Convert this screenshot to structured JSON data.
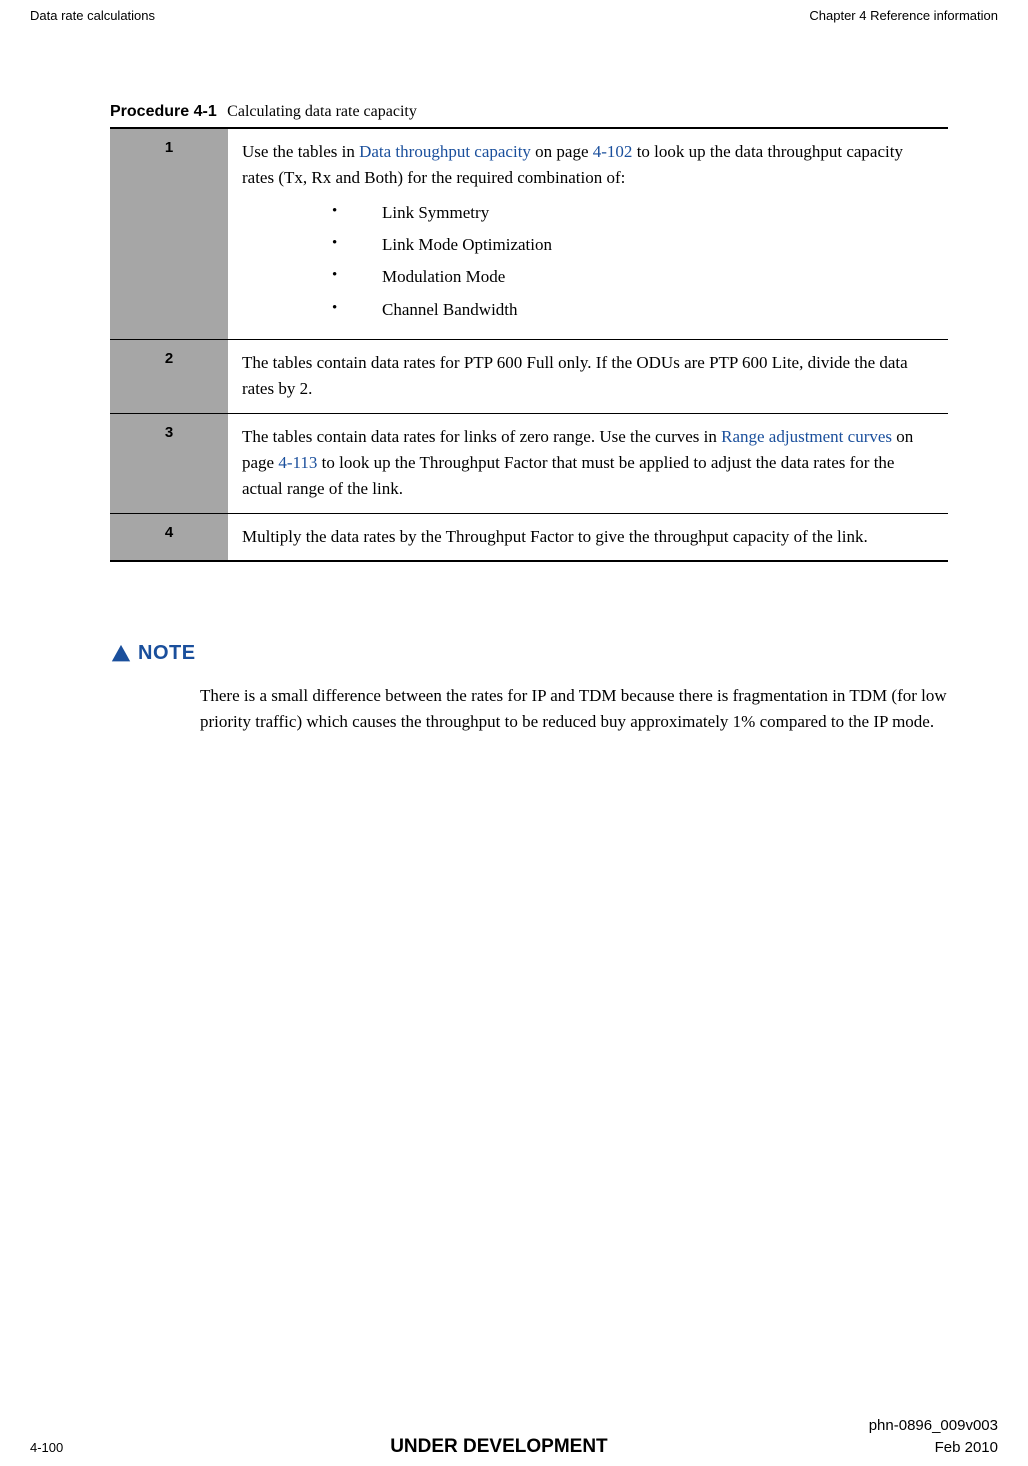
{
  "header": {
    "left": "Data rate calculations",
    "right": "Chapter 4 Reference information"
  },
  "procedure": {
    "label": "Procedure 4-1",
    "title": "Calculating data rate capacity",
    "steps": [
      {
        "num": "1",
        "text_before_link": "Use the tables in ",
        "link1_text": "Data throughput capacity",
        "text_mid1": " on page ",
        "link2_text": "4-102",
        "text_after": " to look up the data throughput capacity rates (Tx, Rx and Both) for the required combination of:",
        "bullets": [
          "Link Symmetry",
          "Link Mode Optimization",
          "Modulation Mode",
          "Channel Bandwidth"
        ]
      },
      {
        "num": "2",
        "text": "The tables contain data rates for PTP 600 Full only. If the ODUs are  PTP 600 Lite, divide the data rates by 2."
      },
      {
        "num": "3",
        "text_before_link": "The tables contain data rates for links of zero range. Use the curves in ",
        "link1_text": "Range adjustment curves",
        "text_mid1": " on page ",
        "link2_text": "4-113",
        "text_after": " to look up the Throughput Factor that must be applied to adjust the data rates for the actual range of the link."
      },
      {
        "num": "4",
        "text": "Multiply the data rates by the Throughput Factor to give the throughput capacity of the link."
      }
    ]
  },
  "note": {
    "heading": "NOTE",
    "body": "There is a small difference between the rates for IP and TDM because there is fragmentation in TDM (for low priority traffic) which causes the throughput to be reduced buy approximately 1% compared to the IP mode."
  },
  "footer": {
    "doc_id": "phn-0896_009v003",
    "page": "4-100",
    "status": "UNDER DEVELOPMENT",
    "date": "Feb 2010"
  }
}
